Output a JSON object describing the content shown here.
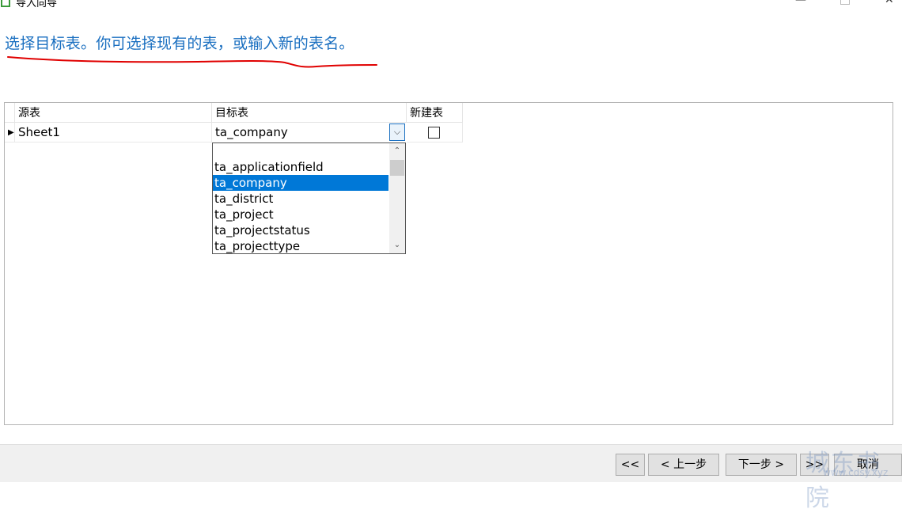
{
  "window": {
    "title": "导入向导",
    "minimize_label": "—",
    "close_label": "✕"
  },
  "instruction": "选择目标表。你可选择现有的表，或输入新的表名。",
  "grid": {
    "headers": {
      "source": "源表",
      "target": "目标表",
      "new_table": "新建表"
    },
    "rows": [
      {
        "marker": "▶",
        "source": "Sheet1",
        "target": "ta_company",
        "new_table_checked": false
      }
    ],
    "dropdown_arrow": "⌵"
  },
  "dropdown": {
    "items": [
      "",
      "ta_applicationfield",
      "ta_company",
      "ta_district",
      "ta_project",
      "ta_projectstatus",
      "ta_projecttype"
    ],
    "selected": "ta_company",
    "scroll_up": "⌃",
    "scroll_down": "⌄"
  },
  "buttons": {
    "first": "<<",
    "prev": "< 上一步",
    "next": "下一步 >",
    "last": ">>",
    "cancel": "取消"
  },
  "watermark": {
    "text": "城东书院",
    "url": "www.cdsy.xyz"
  },
  "colors": {
    "accent": "#1a6fc0",
    "selection": "#0078d7",
    "annotation": "#e00000"
  }
}
